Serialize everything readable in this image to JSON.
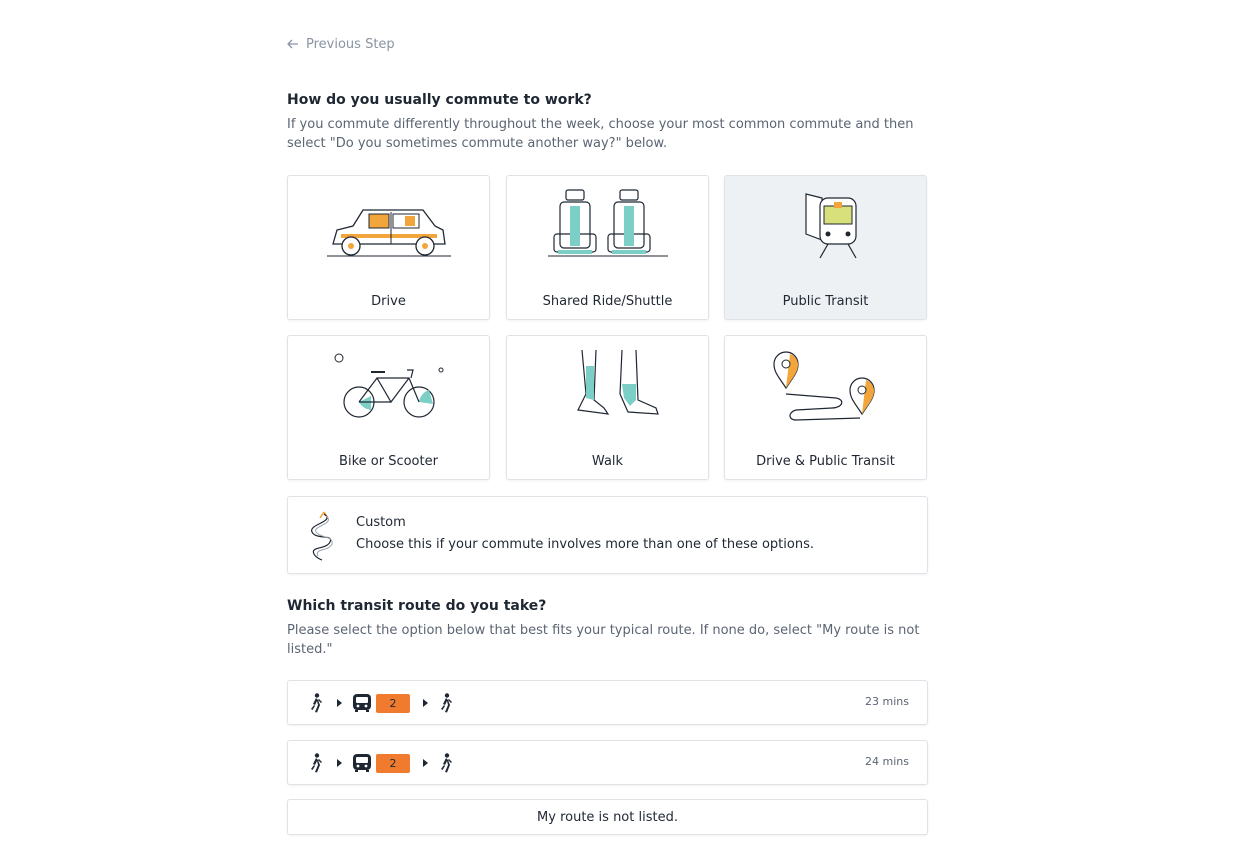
{
  "nav": {
    "previous_step": "Previous Step"
  },
  "question1": {
    "title": "How do you usually commute to work?",
    "description": "If you commute differently throughout the week, choose your most common commute and then select \"Do you sometimes commute another way?\" below.",
    "options": [
      {
        "label": "Drive",
        "icon": "car-icon",
        "selected": false
      },
      {
        "label": "Shared Ride/Shuttle",
        "icon": "seats-icon",
        "selected": false
      },
      {
        "label": "Public Transit",
        "icon": "train-icon",
        "selected": true
      },
      {
        "label": "Bike or Scooter",
        "icon": "bicycle-icon",
        "selected": false
      },
      {
        "label": "Walk",
        "icon": "walking-legs-icon",
        "selected": false
      },
      {
        "label": "Drive & Public Transit",
        "icon": "route-pins-icon",
        "selected": false
      }
    ],
    "custom": {
      "title": "Custom",
      "description": "Choose this if your commute involves more than one of these options.",
      "icon": "winding-path-icon"
    }
  },
  "question2": {
    "title": "Which transit route do you take?",
    "description": "Please select the option below that best fits your typical route. If none do, select \"My route is not listed.\"",
    "routes": [
      {
        "steps": [
          "walk",
          "bus",
          "walk"
        ],
        "bus_number": "2",
        "duration": "23 mins"
      },
      {
        "steps": [
          "walk",
          "bus",
          "walk"
        ],
        "bus_number": "2",
        "duration": "24 mins"
      }
    ],
    "not_listed": "My route is not listed."
  },
  "colors": {
    "accent_orange": "#f07b2e",
    "teal": "#7ccfc6",
    "selected_bg": "#eef1f4"
  }
}
